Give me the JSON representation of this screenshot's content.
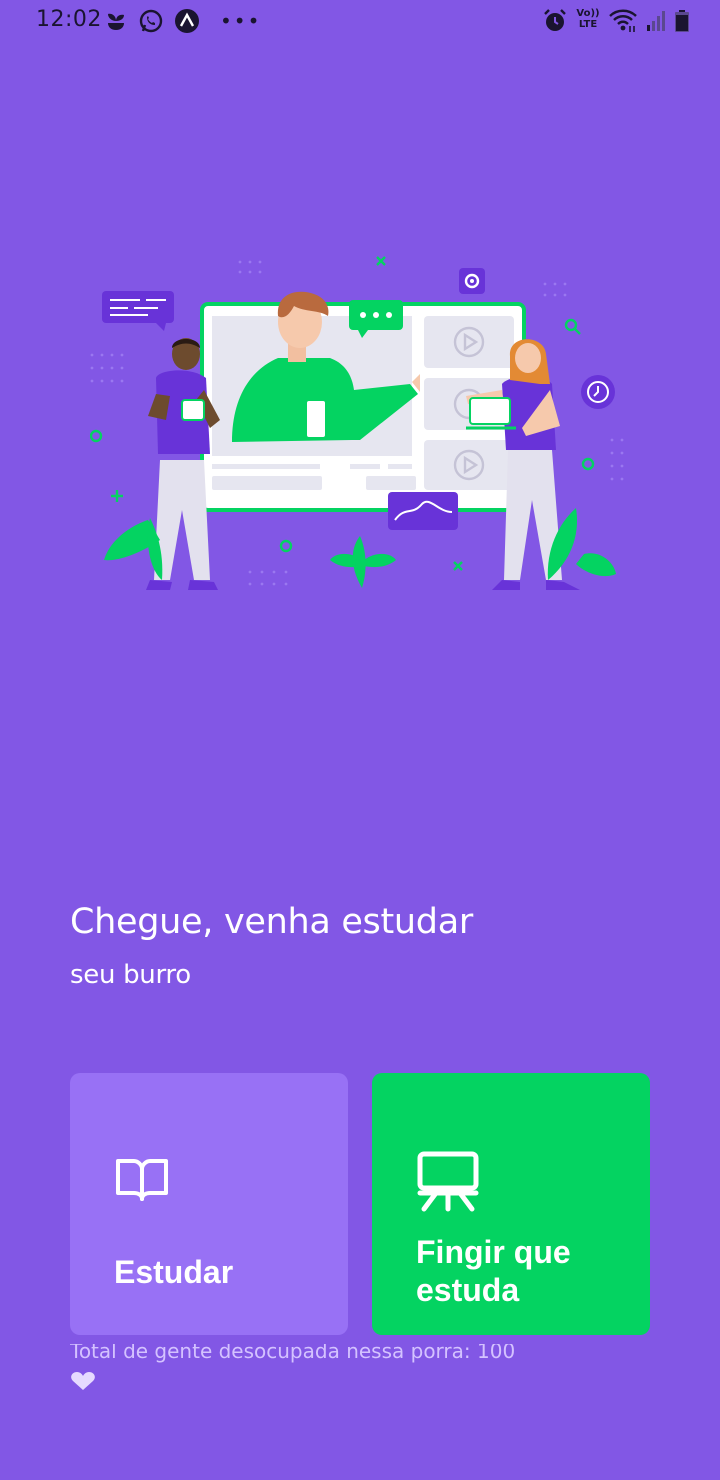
{
  "status_bar": {
    "time": "12:02",
    "left_icons": [
      "plant-icon",
      "whatsapp-icon",
      "expo-icon"
    ],
    "overflow": "•••",
    "right_icons": [
      "alarm-icon",
      "volte-icon",
      "wifi-icon",
      "signal-icon",
      "battery-icon"
    ],
    "volte_label_top": "Vo))",
    "volte_label_bottom": "LTE"
  },
  "hero": {
    "alt": "Pessoas estudando online",
    "colors": {
      "green": "#04D361",
      "purple_dark": "#6833D8",
      "screen": "#F0F0F7"
    }
  },
  "main": {
    "title": "Chegue, venha estudar",
    "subtitle": "seu burro"
  },
  "buttons": {
    "study": {
      "label": "Estudar",
      "icon": "book-open-icon",
      "color": "#9871F5"
    },
    "pretend": {
      "label": "Fingir que estuda",
      "icon": "presentation-icon",
      "color": "#04D361"
    }
  },
  "footer": {
    "text": "Total de gente desocupada nessa porra: 100",
    "icon": "heart-icon",
    "heart_color": "#E6DAFF"
  },
  "theme": {
    "background": "#8257E5"
  }
}
